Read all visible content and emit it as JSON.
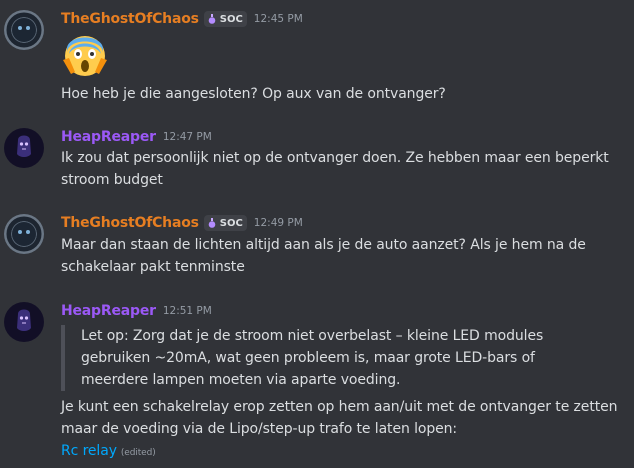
{
  "messages": [
    {
      "author": "TheGhostOfChaos",
      "tag": "SOC",
      "time": "12:45 PM",
      "emoji": "screaming-face-emoji",
      "text": "Hoe heb je die aangesloten? Op aux van de ontvanger?"
    },
    {
      "author": "HeapReaper",
      "time": "12:47 PM",
      "lines": [
        "Ik zou dat persoonlijk niet op de ontvanger doen. Ze hebben maar een beperkt",
        "stroom budget"
      ]
    },
    {
      "author": "TheGhostOfChaos",
      "tag": "SOC",
      "time": "12:49 PM",
      "lines": [
        "Maar dan staan de lichten altijd aan als je de auto aanzet? Als je hem na de",
        "schakelaar pakt tenminste"
      ]
    },
    {
      "author": "HeapReaper",
      "time": "12:51 PM",
      "quote": [
        "Let op: Zorg dat je de stroom niet overbelast – kleine LED modules",
        "gebruiken ~20mA, wat geen probleem is, maar grote LED-bars of",
        "meerdere lampen moeten via aparte voeding."
      ],
      "lines": [
        "Je kunt een schakelrelay erop zetten op hem aan/uit met de ontvanger te zetten",
        "maar de voeding via de Lipo/step-up trafo te laten lopen:"
      ],
      "link": "Rc relay",
      "edited": "(edited)"
    }
  ],
  "colors": {
    "background": "#313338",
    "orange_name": "#e67e22",
    "purple_name": "#9b59f6",
    "link": "#00a8fc"
  }
}
